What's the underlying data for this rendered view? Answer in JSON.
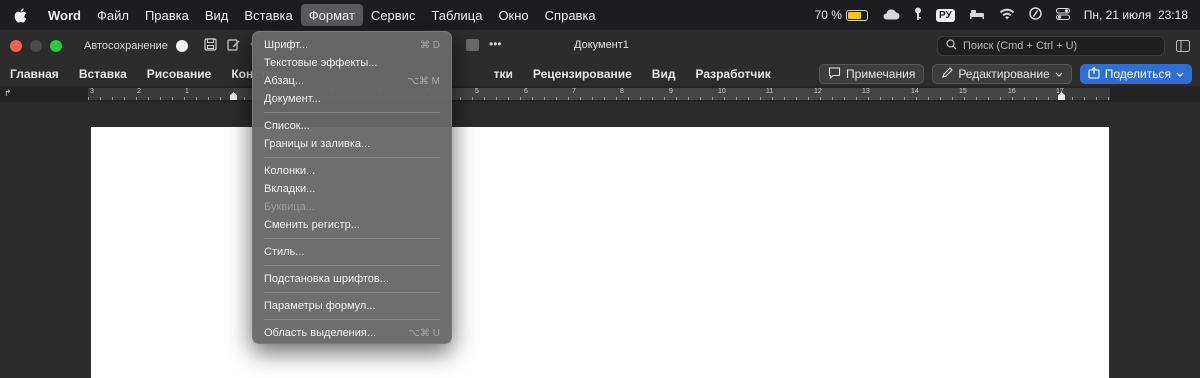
{
  "menubar": {
    "app": "Word",
    "items": [
      "Файл",
      "Правка",
      "Вид",
      "Вставка",
      "Формат",
      "Сервис",
      "Таблица",
      "Окно",
      "Справка"
    ],
    "active": "Формат",
    "battery": "70 %",
    "battery_level": 0.7,
    "keyboard_layout": "РУ",
    "datetime": "Пн, 21 июля  23:18"
  },
  "titlebar": {
    "autosave_label": "Автосохранение",
    "doc_title": "Документ1",
    "search_placeholder": "Поиск (Cmd + Ctrl + U)"
  },
  "ribbon": {
    "tabs": [
      "Главная",
      "Вставка",
      "Рисование",
      "Констру",
      "Рецензирование",
      "Вид",
      "Разработчик"
    ],
    "hidden_fragment": "тки",
    "comments": "Примечания",
    "editing": "Редактирование",
    "share": "Поделиться"
  },
  "ruler": {
    "numbers": [
      "3",
      "2",
      "1",
      "1",
      "2",
      "3",
      "4",
      "5",
      "6",
      "7",
      "8",
      "9",
      "10",
      "11",
      "12",
      "13",
      "14",
      "15",
      "16",
      "17"
    ]
  },
  "format_menu": {
    "groups": [
      [
        {
          "label": "Шрифт...",
          "shortcut": "⌘ D",
          "enabled": true
        },
        {
          "label": "Текстовые эффекты...",
          "shortcut": "",
          "enabled": true
        },
        {
          "label": "Абзац...",
          "shortcut": "⌥⌘ M",
          "enabled": true
        },
        {
          "label": "Документ...",
          "shortcut": "",
          "enabled": true
        }
      ],
      [
        {
          "label": "Список...",
          "shortcut": "",
          "enabled": true
        },
        {
          "label": "Границы и заливка...",
          "shortcut": "",
          "enabled": true
        }
      ],
      [
        {
          "label": "Колонки...",
          "shortcut": "",
          "enabled": true
        },
        {
          "label": "Вкладки...",
          "shortcut": "",
          "enabled": true
        },
        {
          "label": "Буквица...",
          "shortcut": "",
          "enabled": false
        },
        {
          "label": "Сменить регистр...",
          "shortcut": "",
          "enabled": true
        }
      ],
      [
        {
          "label": "Стиль...",
          "shortcut": "",
          "enabled": true
        }
      ],
      [
        {
          "label": "Подстановка шрифтов...",
          "shortcut": "",
          "enabled": true
        }
      ],
      [
        {
          "label": "Параметры формул...",
          "shortcut": "",
          "enabled": true
        }
      ],
      [
        {
          "label": "Область выделения...",
          "shortcut": "⌥⌘ U",
          "enabled": true
        }
      ]
    ]
  }
}
